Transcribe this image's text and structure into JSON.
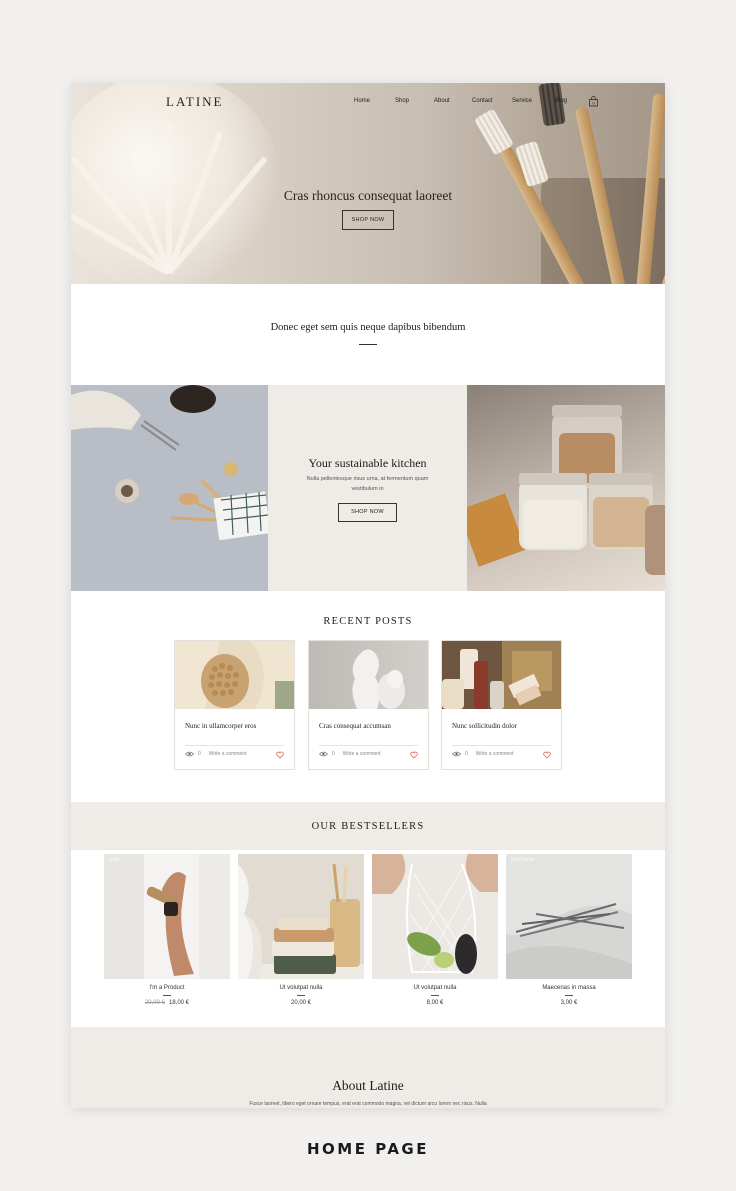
{
  "header": {
    "logo": "LATINE",
    "nav": [
      "Home",
      "Shop",
      "About",
      "Contact",
      "Service",
      "Blog"
    ],
    "cart_count": "0"
  },
  "hero": {
    "title": "Cras rhoncus consequat laoreet",
    "button": "SHOP NOW"
  },
  "intro": {
    "text": "Donec eget sem quis neque dapibus bibendum"
  },
  "kitchen": {
    "title": "Your sustainable kitchen",
    "subtitle": "Nulla pellentesque risus urna, at fermentum quam vestibulum in",
    "button": "SHOP NOW"
  },
  "recent_posts": {
    "title": "RECENT POSTS",
    "posts": [
      {
        "title": "Nunc in ullamcorper eros",
        "views": "0",
        "comment": "Write a comment"
      },
      {
        "title": "Cras consequat accumsan",
        "views": "0",
        "comment": "Write a comment"
      },
      {
        "title": "Nunc sollicitudin dolor",
        "views": "0",
        "comment": "Write a comment"
      }
    ]
  },
  "bestsellers": {
    "title": "OUR BESTSELLERS",
    "products": [
      {
        "name": "I'm a Product",
        "old_price": "20,00 €",
        "price": "18,00 €",
        "tag": "Sale"
      },
      {
        "name": "Ut volutpat nulla",
        "old_price": "",
        "price": "20,00 €",
        "tag": ""
      },
      {
        "name": "Ut volutpat nulla",
        "old_price": "",
        "price": "8,00 €",
        "tag": ""
      },
      {
        "name": "Maecenas in massa",
        "old_price": "",
        "price": "3,00 €",
        "tag": "Best Seller"
      }
    ]
  },
  "about": {
    "title": "About Latine",
    "text": "Fusce laoreet, libero eget ornare tempus, erat erat commodo magna, vel dictum arcu lorem nec risus. Nulla"
  },
  "caption": "HOME PAGE",
  "colors": {
    "background": "#f1f0ee",
    "band": "#efebe7",
    "text": "#1f1b18",
    "heart": "#d9694f"
  }
}
